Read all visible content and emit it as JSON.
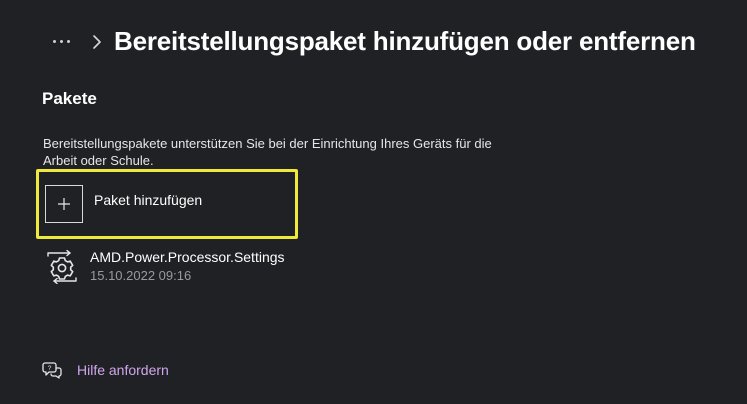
{
  "header": {
    "more_icon": "ellipsis-icon",
    "chevron_icon": "chevron-right-icon",
    "title": "Bereitstellungspaket hinzufügen oder entfernen"
  },
  "section": {
    "title": "Pakete",
    "description": "Bereitstellungspakete unterstützen Sie bei der Einrichtung Ihres Geräts für die Arbeit oder Schule."
  },
  "add_package": {
    "icon": "plus-icon",
    "label": "Paket hinzufügen",
    "highlight_color": "#f0e83a"
  },
  "packages": [
    {
      "icon": "package-settings-icon",
      "name": "AMD.Power.Processor.Settings",
      "date": "15.10.2022 09:16"
    }
  ],
  "help": {
    "icon": "help-chat-icon",
    "label": "Hilfe anfordern",
    "link_color": "#d0a6ec"
  },
  "colors": {
    "background": "#202125",
    "text_primary": "#ffffff",
    "text_secondary": "#9a9a9a"
  }
}
